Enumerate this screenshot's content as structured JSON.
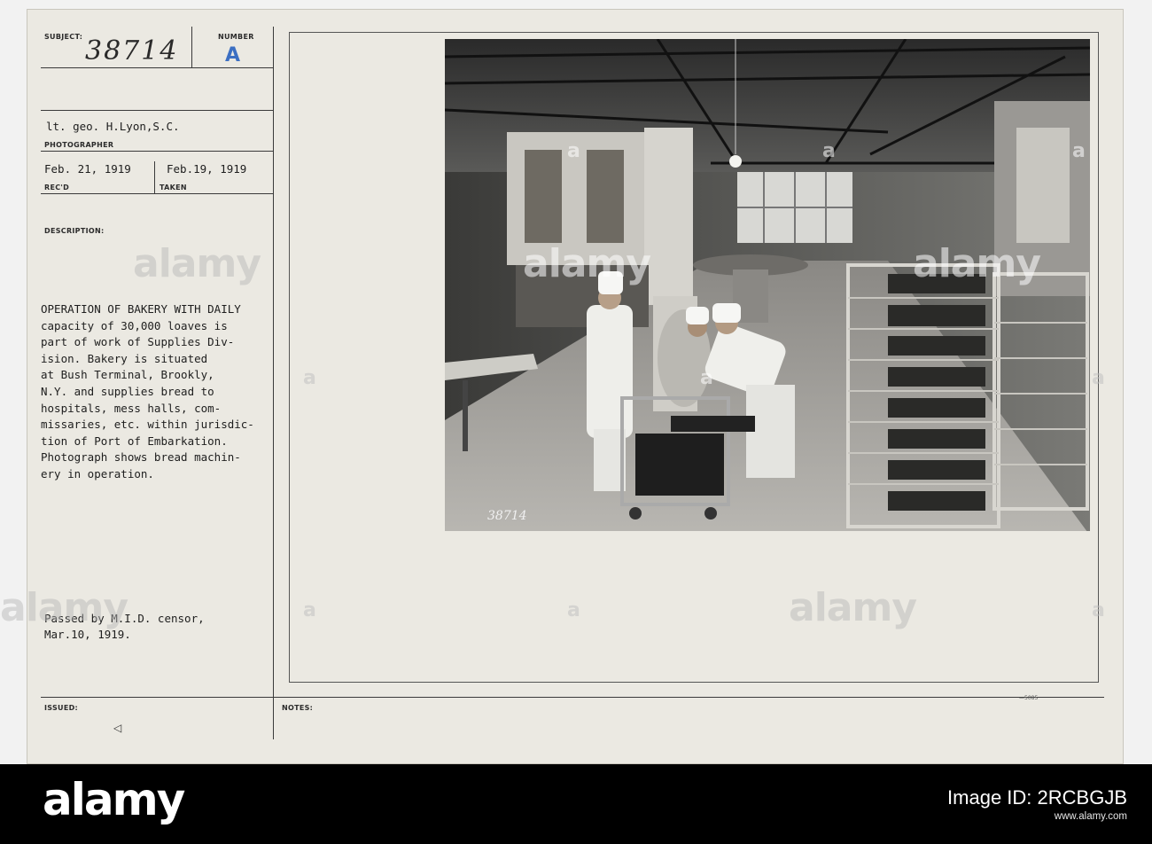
{
  "card": {
    "subject_label": "SUBJECT:",
    "subject_value": "38714",
    "number_label": "NUMBER",
    "number_value": "A",
    "photographer_value": "lt. geo. H.Lyon,S.C.",
    "photographer_label": "PHOTOGRAPHER",
    "recd_value": "Feb. 21, 1919",
    "recd_label": "REC'D",
    "taken_value": "Feb.19, 1919",
    "taken_label": "TAKEN",
    "description_label": "DESCRIPTION:",
    "description_lines": [
      "OPERATION OF BAKERY WITH DAILY",
      "capacity of 30,000 loaves is",
      "part of work of Supplies Div-",
      "ision. Bakery is situated",
      "at Bush Terminal, Brookly,",
      "N.Y. and supplies bread to",
      "hospitals, mess halls, com-",
      "missaries, etc. within jurisdic-",
      "tion of Port of Embarkation.",
      "Photograph shows bread machin-",
      "ery in operation."
    ],
    "censor_line1": "Passed by M.I.D. censor,",
    "censor_line2": "Mar.10, 1919.",
    "issued_label": "ISSUED:",
    "notes_label": "NOTES:",
    "photo_number": "38714",
    "issued_mark": "◁",
    "notes_mark": "—5085"
  },
  "watermark": {
    "text": "alamy",
    "mark": "a"
  },
  "banner": {
    "logo": "alamy",
    "image_id_line": "Image ID: 2RCBGJB",
    "url": "www.alamy.com"
  },
  "colors": {
    "card": "#ebe9e2",
    "ink": "#1e1e1e",
    "banner": "#000000"
  }
}
